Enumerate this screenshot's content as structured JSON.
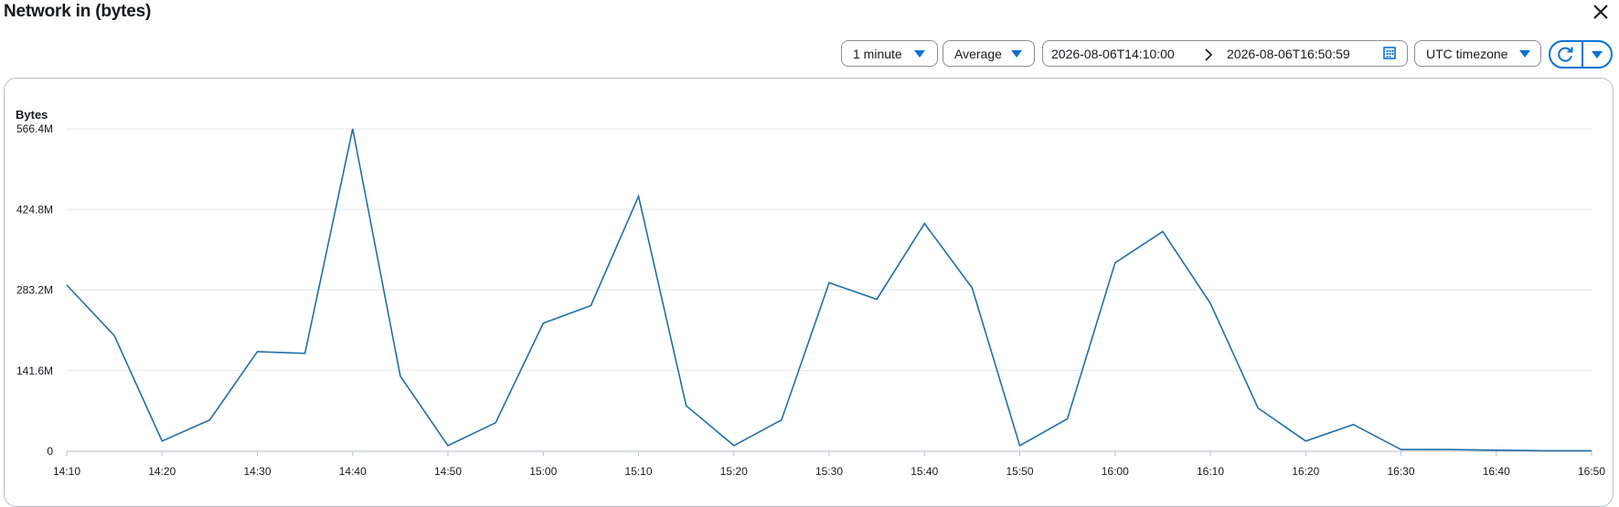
{
  "header": {
    "title": "Network in (bytes)"
  },
  "controls": {
    "period": "1 minute",
    "statistic": "Average",
    "date_start": "2026-08-06T14:10:00",
    "date_end": "2026-08-06T16:50:59",
    "timezone": "UTC timezone"
  },
  "icons": {
    "close": "close-icon",
    "calendar": "calendar-icon",
    "refresh": "refresh-icon",
    "dropdown": "caret-down-icon",
    "separator": "chevron-right-icon"
  },
  "colors": {
    "series": "#1f6fab",
    "accent": "#0972d3",
    "grid": "#e3e5e8"
  },
  "chart_data": {
    "type": "line",
    "ylabel": "Bytes",
    "ylim": [
      0,
      566.4
    ],
    "yticks": [
      "0",
      "141.6M",
      "283.2M",
      "424.8M",
      "566.4M"
    ],
    "ytick_values": [
      0,
      141.6,
      283.2,
      424.8,
      566.4
    ],
    "xticks": [
      "14:10",
      "14:20",
      "14:30",
      "14:40",
      "14:50",
      "15:00",
      "15:10",
      "15:20",
      "15:30",
      "15:40",
      "15:50",
      "16:00",
      "16:10",
      "16:20",
      "16:30",
      "16:40",
      "16:50"
    ],
    "grid": true,
    "series": [
      {
        "x": [
          "14:10",
          "14:15",
          "14:20",
          "14:25",
          "14:30",
          "14:35",
          "14:40",
          "14:45",
          "14:50",
          "14:55",
          "15:00",
          "15:05",
          "15:10",
          "15:15",
          "15:20",
          "15:25",
          "15:30",
          "15:35",
          "15:40",
          "15:45",
          "15:50",
          "15:55",
          "16:00",
          "16:05",
          "16:10",
          "16:15",
          "16:20",
          "16:25",
          "16:30",
          "16:35",
          "16:40",
          "16:45",
          "16:50"
        ],
        "values": [
          292,
          203,
          18,
          55,
          175,
          172,
          566.4,
          132,
          10,
          50,
          225,
          256,
          448,
          80,
          10,
          55,
          296,
          267,
          400,
          287,
          10,
          57,
          331,
          386,
          260,
          76,
          18,
          47,
          3,
          3,
          2,
          1,
          1
        ]
      }
    ]
  }
}
